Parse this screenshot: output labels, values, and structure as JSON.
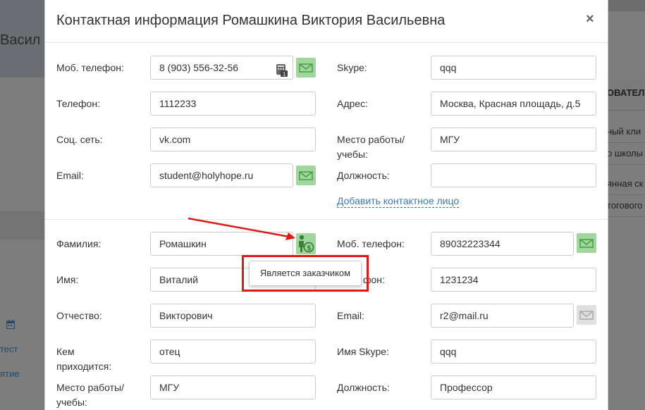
{
  "background": {
    "left_title": "Васил",
    "left_links": [
      "тест",
      "ятие"
    ],
    "right_title": "ОВАТЕЛ",
    "right_rows": [
      "ный кли",
      "о школы",
      "янная ск",
      "тогового"
    ]
  },
  "modal": {
    "title": "Контактная информация Ромашкина Виктория Васильевна",
    "close_label": "×",
    "student": {
      "mobile_label": "Моб. телефон:",
      "mobile_value": "8 (903) 556-32-56",
      "phone_label": "Телефон:",
      "phone_value": "1112233",
      "social_label": "Соц. сеть:",
      "social_value": "vk.com",
      "email_label": "Email:",
      "email_value": "student@holyhope.ru",
      "skype_label": "Skype:",
      "skype_value": "qqq",
      "address_label": "Адрес:",
      "address_value": "Москва, Красная площадь, д.5",
      "work_label": "Место работы/ учебы:",
      "work_value": "МГУ",
      "position_label": "Должность:",
      "position_value": "",
      "add_contact_link": "Добавить контактное лицо"
    },
    "contact": {
      "surname_label": "Фамилия:",
      "surname_value": "Ромашкин",
      "name_label": "Имя:",
      "name_value": "Виталий",
      "patronymic_label": "Отчество:",
      "patronymic_value": "Викторович",
      "relation_label": "Кем приходится:",
      "relation_value": "отец",
      "work_label": "Место работы/ учебы:",
      "work_value": "МГУ",
      "mobile_label": "Моб. телефон:",
      "mobile_value": "89032223344",
      "phone_label_partial": "фон:",
      "phone_value": "1231234",
      "email_label": "Email:",
      "email_value": "r2@mail.ru",
      "skype_label": "Имя Skype:",
      "skype_value": "qqq",
      "position_label": "Должность:",
      "position_value": "Профессор"
    },
    "tooltip_text": "Является заказчиком"
  },
  "colors": {
    "accent_green": "#9fd79d",
    "icon_green": "#3f7f3c",
    "link_blue": "#3a7ab5",
    "annotation_red": "#e01818"
  },
  "icons": [
    "envelope-icon",
    "sms-icon",
    "customer-payer-icon",
    "calendar-icon",
    "close-icon"
  ]
}
